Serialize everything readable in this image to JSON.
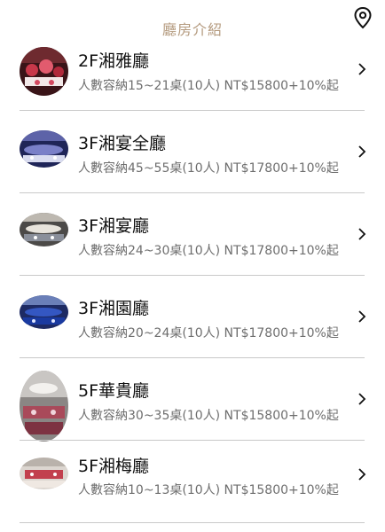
{
  "header": {
    "title": "廳房介紹",
    "location_icon": "map-pin-icon"
  },
  "halls": [
    {
      "name": "2F湘雅廳",
      "description": "人數容納15~21桌(10人) NT$15800+10%起"
    },
    {
      "name": "3F湘宴全廳",
      "description": "人數容納45~55桌(10人) NT$17800+10%起"
    },
    {
      "name": "3F湘宴廳",
      "description": "人數容納24~30桌(10人) NT$17800+10%起"
    },
    {
      "name": "3F湘園廳",
      "description": "人數容納20~24桌(10人) NT$17800+10%起"
    },
    {
      "name": "5F華貴廳",
      "description": "人數容納30~35桌(10人) NT$15800+10%起"
    },
    {
      "name": "5F湘梅廳",
      "description": "人數容納10~13桌(10人) NT$15800+10%起"
    }
  ],
  "colors": {
    "header_title": "#b49a7e",
    "name_text": "#111111",
    "desc_text": "#6e6e6e",
    "divider": "#c9c9c9"
  },
  "icons": {
    "row_arrow": "chevron-right-icon"
  }
}
